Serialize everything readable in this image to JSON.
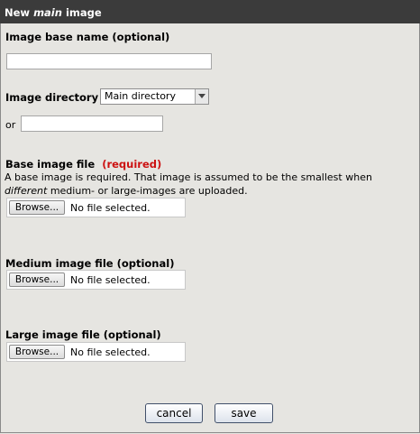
{
  "header": {
    "title_prefix": "New ",
    "title_emph": "main",
    "title_suffix": " image"
  },
  "base_name": {
    "label": "Image base name (optional)",
    "value": ""
  },
  "directory": {
    "label": "Image directory",
    "selected": "Main directory",
    "or_label": "or",
    "value": ""
  },
  "base_file": {
    "label": "Base image file",
    "required": "(required)",
    "desc_line1": "A base image is required. That image is assumed to be the smallest when",
    "desc_line2_emph": "different",
    "desc_line2_rest": " medium- or large-images are uploaded.",
    "browse": "Browse...",
    "status": "No file selected."
  },
  "medium_file": {
    "label": "Medium image file (optional)",
    "browse": "Browse...",
    "status": "No file selected."
  },
  "large_file": {
    "label": "Large image file (optional)",
    "browse": "Browse...",
    "status": "No file selected."
  },
  "actions": {
    "cancel": "cancel",
    "save": "save"
  }
}
